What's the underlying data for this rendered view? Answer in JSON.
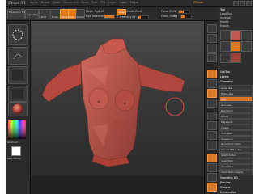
{
  "app": {
    "title": "ZBrush 3.1",
    "menus": [
      "Alpha",
      "Brush",
      "Color",
      "Document",
      "Draw",
      "Edit",
      "File",
      "Layer",
      "Light",
      "Macro",
      "Marker",
      "Material",
      "Movie",
      "Picker",
      "Preferences",
      "Render",
      "Stencil",
      "Stroke",
      "Texture",
      "Tool",
      "Transform",
      "Zplugin",
      "Zscript"
    ],
    "right_title": "ZBrush"
  },
  "toolbar": {
    "projection_master": "Projection Master",
    "light_box": "Light Box",
    "edit": "Edit",
    "draw": "Draw",
    "move": "Move",
    "scale": "Scale",
    "rotate": "Rotate",
    "mrgb": "Mrgb",
    "rgb": "Rgb",
    "m": "M",
    "zadd": "Zadd",
    "zsub": "Zsub",
    "zcut": "Zcut",
    "rgb_intensity": "Rgb Intensity",
    "z_intensity": "Z Intensity",
    "focal_shift": "Focal Shift",
    "draw_size": "Draw Size",
    "rgb_intensity_value": 100,
    "z_intensity_value": 25,
    "focal_shift_value": 0,
    "draw_size_value": 64
  },
  "left_shelf": {
    "gradient_label": "Gradient",
    "switch_color_label": "SwitchColor"
  },
  "right_panel": {
    "header": "Tool",
    "buttons": [
      "Load Tool",
      "Save As",
      "Import",
      "Export",
      "Clone",
      "Make PolyMesh3D"
    ],
    "subtool": "SubTool",
    "layers": "Layers",
    "geometry": "Geometry",
    "lower_res": "Lower Res",
    "higher_res": "Higher Res",
    "sdiv": "SDiv",
    "sdiv_value": 4,
    "del_lower": "Del Lower",
    "del_higher": "Del Higher",
    "divide": "Divide",
    "smt": "Smt",
    "edge_loop": "Edge Loop",
    "crease": "Crease",
    "uncrease": "UnCrease",
    "crease_lvl": "Crease Lvl",
    "reconstruct_subdiv": "Reconstruct Subdiv",
    "convert_bpr": "Convert BPR to Geo",
    "freeze_subdiv": "Freeze SubDivision Levels",
    "delete_hidden": "Delete Hidden",
    "insert_mesh": "Insert Mesh",
    "close_holes": "Close Holes",
    "check_mesh": "Check Mesh Integrity",
    "geometry_hd": "Geometry HD",
    "preview": "Preview",
    "surface": "Surface",
    "deformation": "Deformation",
    "masking": "Masking",
    "visibility": "Visibility",
    "polygroups": "Polygroups"
  },
  "colors": {
    "accent": "#e07a1b",
    "model": "#c2554b",
    "background": "#3a3a3a"
  }
}
